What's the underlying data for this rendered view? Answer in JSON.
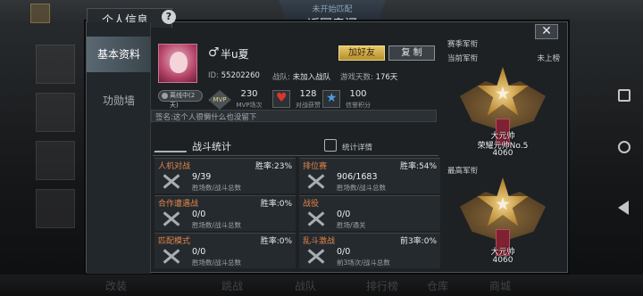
{
  "background": {
    "bottom_nav": [
      "改装",
      "跳战",
      "战队",
      "排行榜",
      "仓库",
      "商城"
    ]
  },
  "return_banner": {
    "sub": "未开始匹配",
    "main": "返回房间"
  },
  "dialog": {
    "title": "个人信息",
    "help_symbol": "?",
    "close_symbol": "✕"
  },
  "tabs": [
    {
      "label": "基本资料"
    },
    {
      "label": "功勋墙"
    }
  ],
  "profile": {
    "online_status": "离线中(2天)",
    "gender_symbol": "♂",
    "name": "半u夏",
    "add_friend_label": "加好友",
    "copy_label": "复 制",
    "id": {
      "label": "ID:",
      "value": "55202260"
    },
    "clan": {
      "label": "战队:",
      "value": "未加入战队"
    },
    "days": {
      "label": "游戏天数:",
      "value": "176天"
    },
    "mvp": {
      "icon_text": "MVP",
      "value": "230",
      "label": "MVP场次"
    },
    "likes": {
      "value": "128",
      "label": "对战获赞"
    },
    "credit": {
      "value": "100",
      "label": "信誉积分"
    },
    "signature": "签名:这个人很懒什么也没留下"
  },
  "battle": {
    "title": "战斗统计",
    "detail_label": "统计详情",
    "cells": [
      {
        "title": "人机对战",
        "rate": "胜率:23%",
        "num": "9/39",
        "sub": "胜场数/战斗总数"
      },
      {
        "title": "排位赛",
        "rate": "胜率:54%",
        "num": "906/1683",
        "sub": "胜场数/战斗总数"
      },
      {
        "title": "合作遭遇战",
        "rate": "胜率:0%",
        "num": "0/0",
        "sub": "胜场数/战斗总数"
      },
      {
        "title": "战役",
        "rate": "",
        "num": "0/0",
        "sub": "胜场/通关"
      },
      {
        "title": "匹配模式",
        "rate": "胜率:0%",
        "num": "0/0",
        "sub": "胜场数/战斗总数"
      },
      {
        "title": "乱斗激战",
        "rate": "前3率:0%",
        "num": "0/0",
        "sub": "前3场次/战斗总数"
      }
    ]
  },
  "rank": {
    "section_title": "赛季军衔",
    "current_label": "当前军衔",
    "not_ranked": "未上榜",
    "current_name": "大元帅",
    "current_rank": "荣耀元帅No.5",
    "current_score": "4060",
    "highest_label": "最高军衔",
    "highest_name": "大元帅",
    "highest_score": "4060"
  },
  "colors": {
    "add_friend": "#d9b552",
    "accent_orange": "#e2854a"
  }
}
